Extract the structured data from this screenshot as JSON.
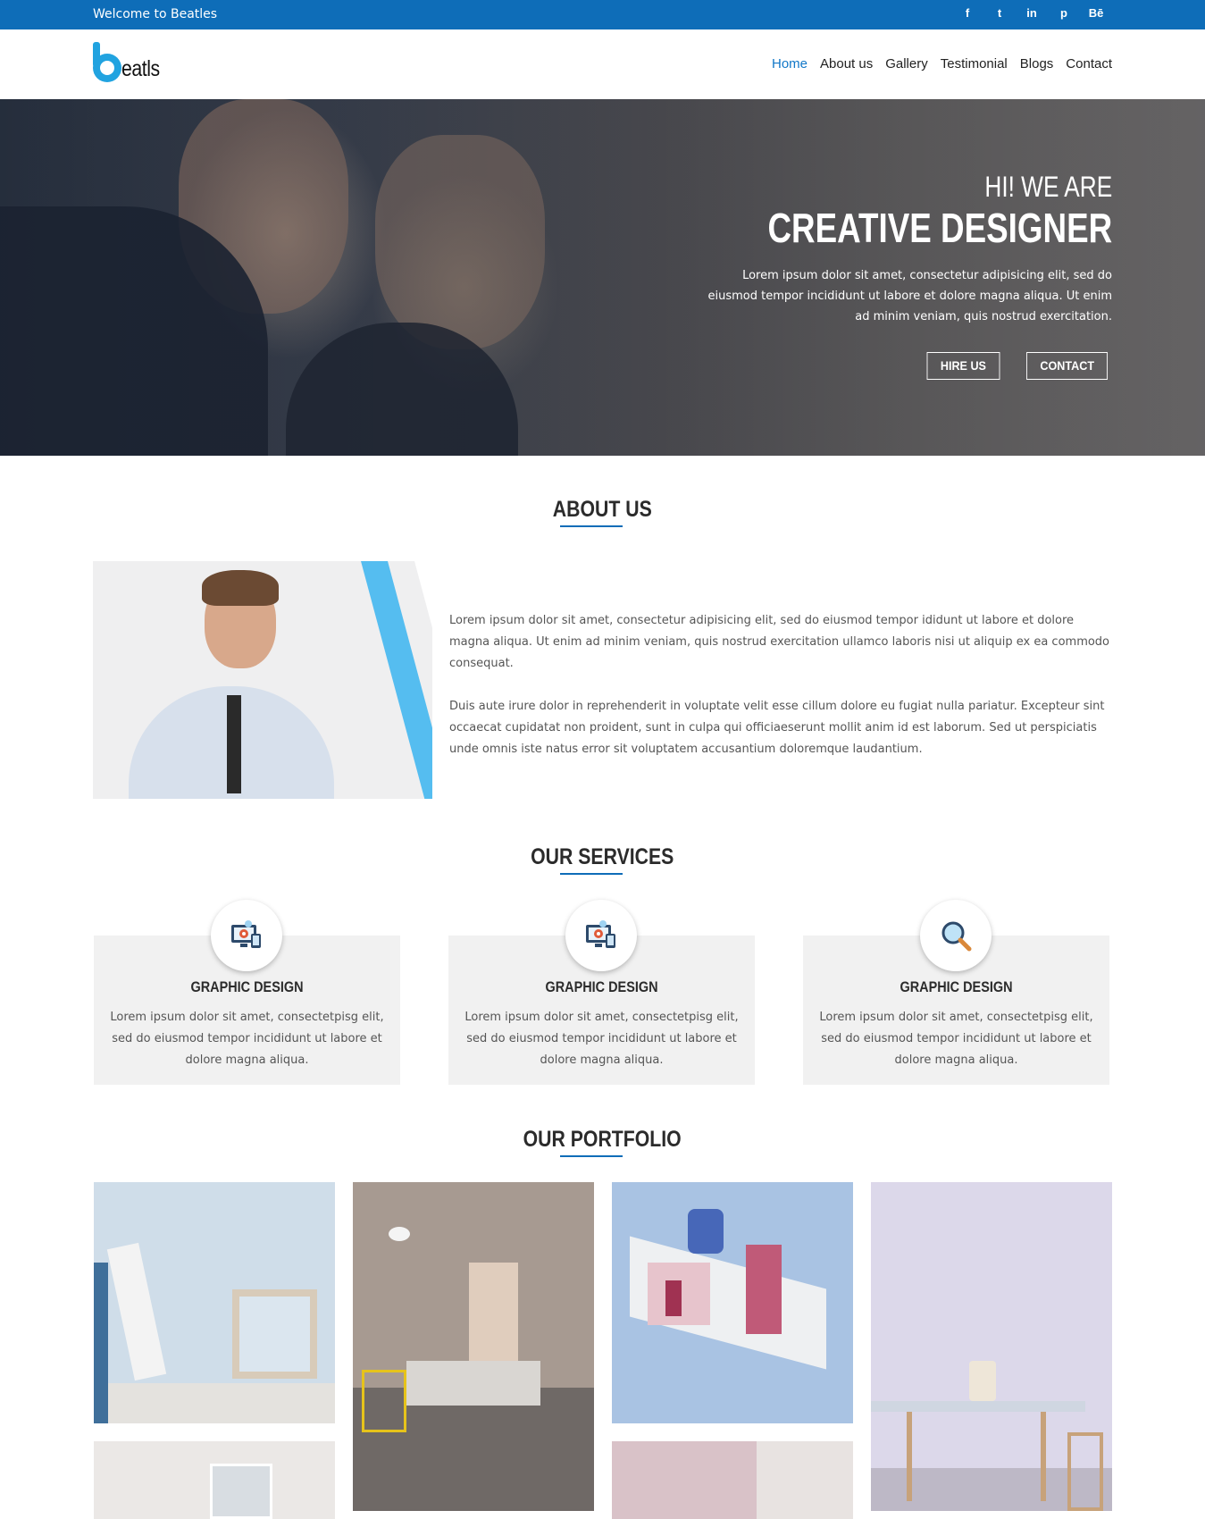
{
  "topbar": {
    "welcome": "Welcome to Beatles",
    "social": [
      "f",
      "t",
      "in",
      "p",
      "Bē"
    ]
  },
  "header": {
    "logo_text": "eatls",
    "nav": [
      "Home",
      "About us",
      "Gallery",
      "Testimonial",
      "Blogs",
      "Contact"
    ],
    "active_nav": "Home"
  },
  "hero": {
    "line1": "HI! WE ARE",
    "line2": "CREATIVE DESIGNER",
    "text": "Lorem ipsum dolor sit amet, consectetur adipisicing elit, sed do eiusmod tempor incididunt ut labore et dolore magna aliqua. Ut enim ad minim veniam, quis nostrud exercitation.",
    "btn_hire": "HIRE US",
    "btn_contact": "CONTACT"
  },
  "about": {
    "title": "ABOUT US",
    "p1": "Lorem ipsum dolor sit amet, consectetur adipisicing elit, sed do eiusmod tempor ididunt ut labore et dolore magna aliqua. Ut enim ad minim veniam, quis nostrud exercitation ullamco laboris nisi ut aliquip ex ea commodo consequat.",
    "p2": "Duis aute irure dolor in reprehenderit in voluptate velit esse cillum dolore eu fugiat nulla pariatur. Excepteur sint occaecat cupidatat non proident, sunt in culpa qui officiaeserunt mollit anim id est laborum. Sed ut perspiciatis unde omnis iste natus error sit voluptatem accusantium doloremque laudantium."
  },
  "services": {
    "title": "OUR SERVICES",
    "items": [
      {
        "title": "GRAPHIC DESIGN",
        "text": "Lorem ipsum dolor sit amet, consectetpisg elit, sed do eiusmod tempor incididunt ut labore et dolore magna aliqua.",
        "icon": "monitor-gear-icon"
      },
      {
        "title": "GRAPHIC DESIGN",
        "text": "Lorem ipsum dolor sit amet, consectetpisg elit, sed do eiusmod tempor incididunt ut labore et dolore magna aliqua.",
        "icon": "monitor-gear-icon"
      },
      {
        "title": "GRAPHIC DESIGN",
        "text": "Lorem ipsum dolor sit amet, consectetpisg elit, sed do eiusmod tempor incididunt ut labore et dolore magna aliqua.",
        "icon": "magnifier-icon"
      }
    ]
  },
  "portfolio": {
    "title": "OUR PORTFOLIO"
  },
  "colors": {
    "brand": "#0e6db8",
    "accent": "#55bdf0"
  }
}
